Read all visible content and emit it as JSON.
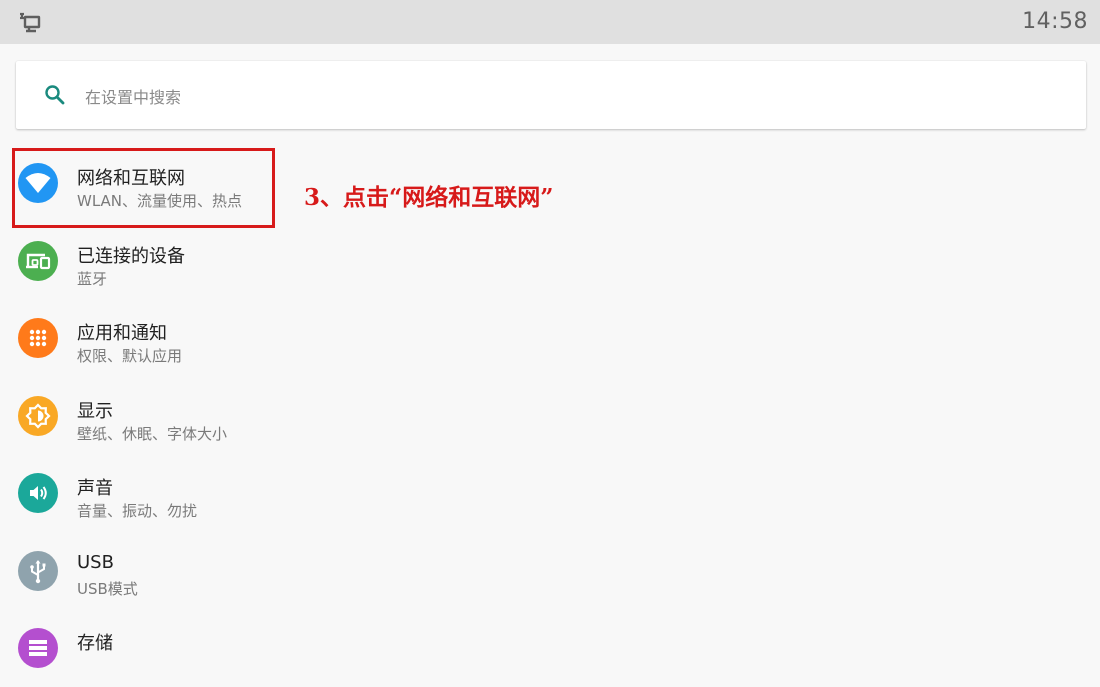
{
  "status_bar": {
    "time": "14:58",
    "left_icon": "computer-monitor-icon"
  },
  "search": {
    "placeholder": "在设置中搜索",
    "icon": "search-icon"
  },
  "settings": [
    {
      "title": "网络和互联网",
      "subtitle": "WLAN、流量使用、热点",
      "icon": "wifi-icon",
      "color": "#2196f3"
    },
    {
      "title": "已连接的设备",
      "subtitle": "蓝牙",
      "icon": "connected-devices-icon",
      "color": "#4caf50"
    },
    {
      "title": "应用和通知",
      "subtitle": "权限、默认应用",
      "icon": "apps-grid-icon",
      "color": "#ff7a1a"
    },
    {
      "title": "显示",
      "subtitle": "壁纸、休眠、字体大小",
      "icon": "brightness-icon",
      "color": "#f9a825"
    },
    {
      "title": "声音",
      "subtitle": "音量、振动、勿扰",
      "icon": "volume-icon",
      "color": "#1ba89a"
    },
    {
      "title": "USB",
      "subtitle": "USB模式",
      "icon": "usb-icon",
      "color": "#8fa3ad"
    },
    {
      "title": "存储",
      "subtitle": "",
      "icon": "storage-icon",
      "color": "#b44fcf"
    }
  ],
  "annotation": {
    "text": "3、点击“网络和互联网”",
    "color": "#d71a1a"
  },
  "colors": {
    "status_bar_bg": "#e0e0e0",
    "page_bg": "#f8f8f8",
    "search_icon": "#1a8a7e"
  }
}
